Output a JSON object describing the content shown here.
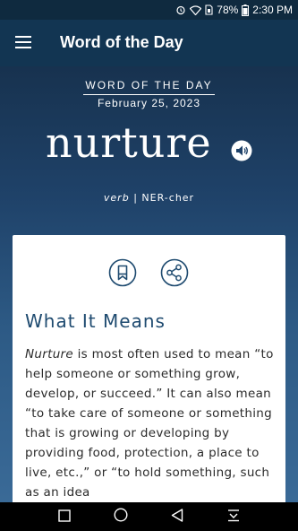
{
  "status": {
    "battery": "78%",
    "time": "2:30 PM"
  },
  "app_bar": {
    "title": "Word of the Day"
  },
  "hero": {
    "label": "WORD OF THE DAY",
    "date": "February 25, 2023",
    "word": "nurture",
    "part_of_speech": "verb",
    "separator": "|",
    "pronunciation": "NER-cher"
  },
  "card": {
    "section_title": "What It Means",
    "definition_term": "Nurture",
    "definition_rest": " is most often used to mean “to help someone or something grow, develop, or succeed.” It can also mean “to take care of someone or something that is growing or developing by providing food, protection, a place to live, etc.,” or “to hold something, such as an idea"
  },
  "icons": {
    "menu": "hamburger-icon",
    "audio": "speaker-icon",
    "bookmark": "bookmark-icon",
    "share": "share-icon",
    "nav": [
      "square-icon",
      "circle-icon",
      "triangle-back-icon",
      "download-icon"
    ]
  },
  "colors": {
    "status_bar": "#0f2a3f",
    "app_bar": "#123552",
    "hero_top": "#17324f",
    "hero_bottom": "#3a6a97",
    "accent": "#1f4b70",
    "card": "#ffffff"
  }
}
